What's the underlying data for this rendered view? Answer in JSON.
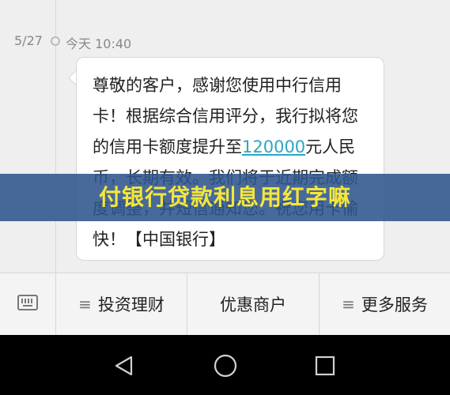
{
  "timeline": {
    "date": "5/27",
    "time": "今天 10:40"
  },
  "message": {
    "text_before": "尊敬的客户，感谢您使用中行信用卡！根据综合信用评分，我行拟将您的信用卡额度提升至",
    "amount": "120000",
    "text_after": "元人民币，长期有效。我们将于近期完成额度调整，并短信通知您。祝您用卡愉快！【中国银行】"
  },
  "overlay_banner": {
    "text": "付银行贷款利息用红字嘛"
  },
  "menu": {
    "items": [
      {
        "label": "投资理财"
      },
      {
        "label": "优惠商户"
      },
      {
        "label": "更多服务"
      }
    ]
  },
  "colors": {
    "background": "#efefef",
    "link_amount": "#2ba6c4",
    "banner_bg": "#2d558c",
    "banner_text": "#f5e63a",
    "nav_bar": "#000000"
  },
  "icons": [
    "keyboard-icon",
    "menu-lines-icon",
    "back-icon",
    "home-icon",
    "recents-icon"
  ]
}
